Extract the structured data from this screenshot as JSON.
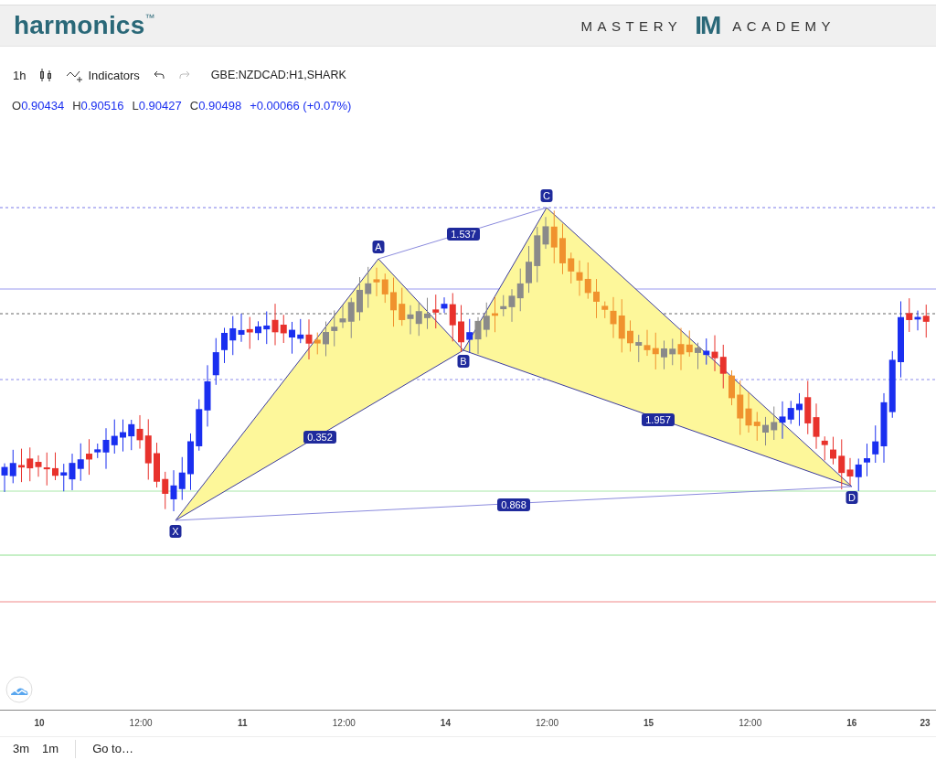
{
  "header": {
    "logo": "harmonics$^{™}$",
    "brand_left": "MASTERY",
    "brand_mark": "IM",
    "brand_right": "ACADEMY"
  },
  "toolbar": {
    "interval": "1h",
    "indicators": "Indicators",
    "symbol": "GBE:NZDCAD:H1,SHARK"
  },
  "ohlc": {
    "items": [
      {
        "label": "O",
        "value": "0.90434"
      },
      {
        "label": "H",
        "value": "0.90516"
      },
      {
        "label": "L",
        "value": "0.90427"
      },
      {
        "label": "C",
        "value": "0.90498"
      }
    ],
    "change": "+0.00066 (+0.07%)"
  },
  "pattern": {
    "points": [
      {
        "label": "X"
      },
      {
        "label": "A"
      },
      {
        "label": "B"
      },
      {
        "label": "C"
      },
      {
        "label": "D"
      }
    ],
    "ratios": [
      {
        "label": "0.352"
      },
      {
        "label": "1.537"
      },
      {
        "label": "1.957"
      },
      {
        "label": "0.868"
      }
    ]
  },
  "time_axis": [
    {
      "text": "10",
      "kind": "day"
    },
    {
      "text": "12:00",
      "kind": "time"
    },
    {
      "text": "11",
      "kind": "day"
    },
    {
      "text": "12:00",
      "kind": "time"
    },
    {
      "text": "14",
      "kind": "day"
    },
    {
      "text": "12:00",
      "kind": "time"
    },
    {
      "text": "15",
      "kind": "day"
    },
    {
      "text": "12:00",
      "kind": "time"
    },
    {
      "text": "16",
      "kind": "day"
    },
    {
      "text": "23",
      "kind": "day"
    }
  ],
  "bottom_bar": {
    "ranges": [
      "3m",
      "1m"
    ],
    "goto": "Go to…"
  }
}
